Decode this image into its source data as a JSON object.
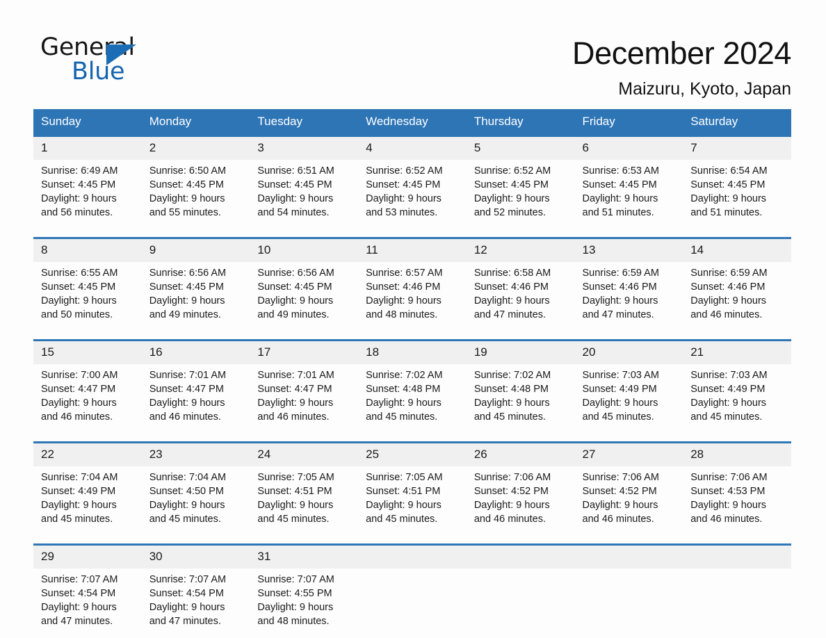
{
  "brand": {
    "name_part1": "General",
    "name_part2": "Blue",
    "accent_color": "#2e75b6",
    "header_bg": "#2e75b6",
    "daynum_bg": "#f0f0f0"
  },
  "header": {
    "month_title": "December 2024",
    "location": "Maizuru, Kyoto, Japan"
  },
  "weekday_headers": [
    "Sunday",
    "Monday",
    "Tuesday",
    "Wednesday",
    "Thursday",
    "Friday",
    "Saturday"
  ],
  "weeks": [
    {
      "days": [
        {
          "num": "1",
          "info": "Sunrise: 6:49 AM\nSunset: 4:45 PM\nDaylight: 9 hours\nand 56 minutes."
        },
        {
          "num": "2",
          "info": "Sunrise: 6:50 AM\nSunset: 4:45 PM\nDaylight: 9 hours\nand 55 minutes."
        },
        {
          "num": "3",
          "info": "Sunrise: 6:51 AM\nSunset: 4:45 PM\nDaylight: 9 hours\nand 54 minutes."
        },
        {
          "num": "4",
          "info": "Sunrise: 6:52 AM\nSunset: 4:45 PM\nDaylight: 9 hours\nand 53 minutes."
        },
        {
          "num": "5",
          "info": "Sunrise: 6:52 AM\nSunset: 4:45 PM\nDaylight: 9 hours\nand 52 minutes."
        },
        {
          "num": "6",
          "info": "Sunrise: 6:53 AM\nSunset: 4:45 PM\nDaylight: 9 hours\nand 51 minutes."
        },
        {
          "num": "7",
          "info": "Sunrise: 6:54 AM\nSunset: 4:45 PM\nDaylight: 9 hours\nand 51 minutes."
        }
      ]
    },
    {
      "days": [
        {
          "num": "8",
          "info": "Sunrise: 6:55 AM\nSunset: 4:45 PM\nDaylight: 9 hours\nand 50 minutes."
        },
        {
          "num": "9",
          "info": "Sunrise: 6:56 AM\nSunset: 4:45 PM\nDaylight: 9 hours\nand 49 minutes."
        },
        {
          "num": "10",
          "info": "Sunrise: 6:56 AM\nSunset: 4:45 PM\nDaylight: 9 hours\nand 49 minutes."
        },
        {
          "num": "11",
          "info": "Sunrise: 6:57 AM\nSunset: 4:46 PM\nDaylight: 9 hours\nand 48 minutes."
        },
        {
          "num": "12",
          "info": "Sunrise: 6:58 AM\nSunset: 4:46 PM\nDaylight: 9 hours\nand 47 minutes."
        },
        {
          "num": "13",
          "info": "Sunrise: 6:59 AM\nSunset: 4:46 PM\nDaylight: 9 hours\nand 47 minutes."
        },
        {
          "num": "14",
          "info": "Sunrise: 6:59 AM\nSunset: 4:46 PM\nDaylight: 9 hours\nand 46 minutes."
        }
      ]
    },
    {
      "days": [
        {
          "num": "15",
          "info": "Sunrise: 7:00 AM\nSunset: 4:47 PM\nDaylight: 9 hours\nand 46 minutes."
        },
        {
          "num": "16",
          "info": "Sunrise: 7:01 AM\nSunset: 4:47 PM\nDaylight: 9 hours\nand 46 minutes."
        },
        {
          "num": "17",
          "info": "Sunrise: 7:01 AM\nSunset: 4:47 PM\nDaylight: 9 hours\nand 46 minutes."
        },
        {
          "num": "18",
          "info": "Sunrise: 7:02 AM\nSunset: 4:48 PM\nDaylight: 9 hours\nand 45 minutes."
        },
        {
          "num": "19",
          "info": "Sunrise: 7:02 AM\nSunset: 4:48 PM\nDaylight: 9 hours\nand 45 minutes."
        },
        {
          "num": "20",
          "info": "Sunrise: 7:03 AM\nSunset: 4:49 PM\nDaylight: 9 hours\nand 45 minutes."
        },
        {
          "num": "21",
          "info": "Sunrise: 7:03 AM\nSunset: 4:49 PM\nDaylight: 9 hours\nand 45 minutes."
        }
      ]
    },
    {
      "days": [
        {
          "num": "22",
          "info": "Sunrise: 7:04 AM\nSunset: 4:49 PM\nDaylight: 9 hours\nand 45 minutes."
        },
        {
          "num": "23",
          "info": "Sunrise: 7:04 AM\nSunset: 4:50 PM\nDaylight: 9 hours\nand 45 minutes."
        },
        {
          "num": "24",
          "info": "Sunrise: 7:05 AM\nSunset: 4:51 PM\nDaylight: 9 hours\nand 45 minutes."
        },
        {
          "num": "25",
          "info": "Sunrise: 7:05 AM\nSunset: 4:51 PM\nDaylight: 9 hours\nand 45 minutes."
        },
        {
          "num": "26",
          "info": "Sunrise: 7:06 AM\nSunset: 4:52 PM\nDaylight: 9 hours\nand 46 minutes."
        },
        {
          "num": "27",
          "info": "Sunrise: 7:06 AM\nSunset: 4:52 PM\nDaylight: 9 hours\nand 46 minutes."
        },
        {
          "num": "28",
          "info": "Sunrise: 7:06 AM\nSunset: 4:53 PM\nDaylight: 9 hours\nand 46 minutes."
        }
      ]
    },
    {
      "days": [
        {
          "num": "29",
          "info": "Sunrise: 7:07 AM\nSunset: 4:54 PM\nDaylight: 9 hours\nand 47 minutes."
        },
        {
          "num": "30",
          "info": "Sunrise: 7:07 AM\nSunset: 4:54 PM\nDaylight: 9 hours\nand 47 minutes."
        },
        {
          "num": "31",
          "info": "Sunrise: 7:07 AM\nSunset: 4:55 PM\nDaylight: 9 hours\nand 48 minutes."
        },
        {
          "num": "",
          "info": ""
        },
        {
          "num": "",
          "info": ""
        },
        {
          "num": "",
          "info": ""
        },
        {
          "num": "",
          "info": ""
        }
      ]
    }
  ]
}
